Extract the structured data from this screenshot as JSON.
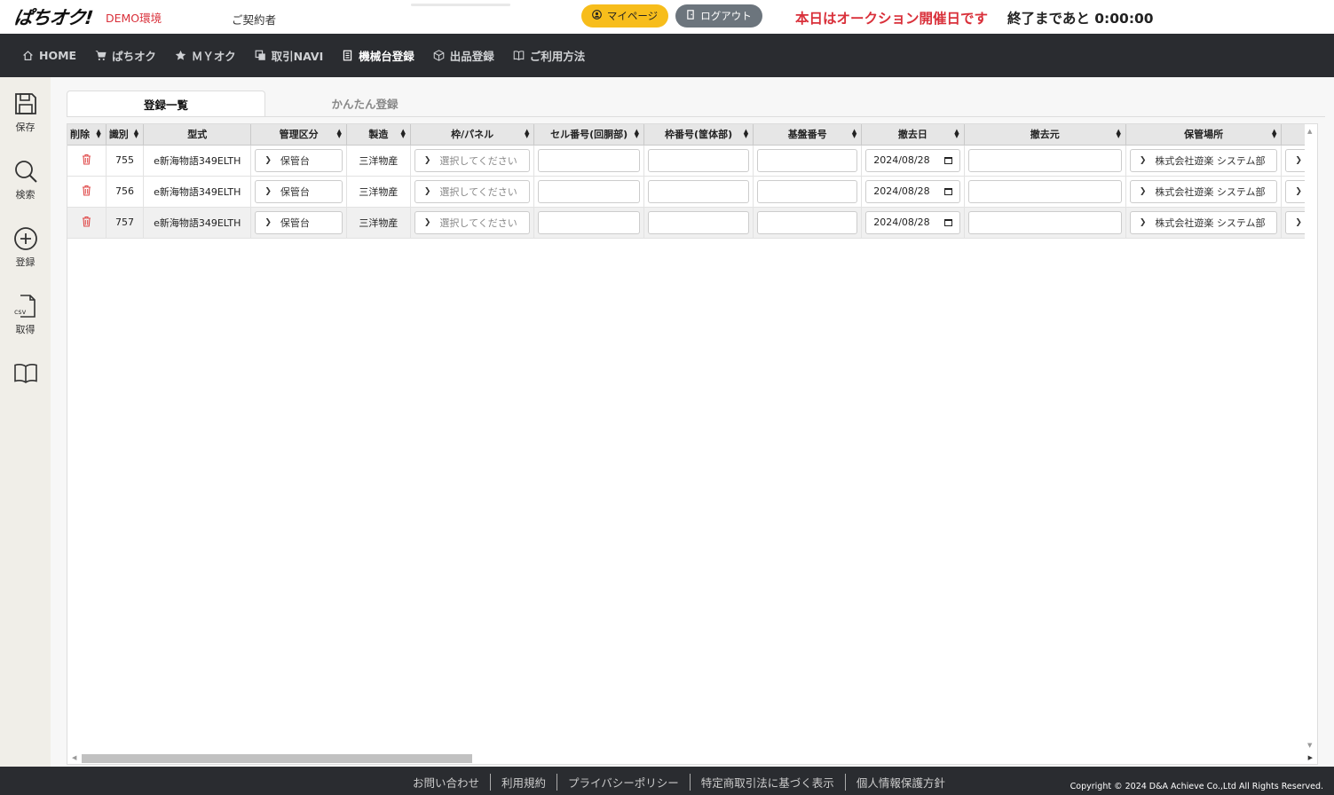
{
  "header": {
    "logo": "ぱちオク!",
    "env_label": "DEMO環境",
    "user_label": "ご契約者",
    "mypage_label": "マイページ",
    "logout_label": "ログアウト",
    "notice": "本日はオークション開催日です",
    "countdown_prefix": "終了まであと",
    "countdown_time": "0:00:00"
  },
  "nav": {
    "items": [
      {
        "label": "HOME",
        "icon": "home-icon"
      },
      {
        "label": "ぱちオク",
        "icon": "cart-icon"
      },
      {
        "label": "ＭＹオク",
        "icon": "star-icon"
      },
      {
        "label": "取引NAVI",
        "icon": "copy-icon"
      },
      {
        "label": "機械台登録",
        "icon": "clipboard-icon"
      },
      {
        "label": "出品登録",
        "icon": "box-icon"
      },
      {
        "label": "ご利用方法",
        "icon": "book-icon"
      }
    ],
    "active_index": 4
  },
  "sidebar": {
    "items": [
      {
        "label": "保存",
        "icon": "save-icon"
      },
      {
        "label": "検索",
        "icon": "search-icon"
      },
      {
        "label": "登録",
        "icon": "add-circle-icon"
      },
      {
        "label": "取得",
        "icon": "csv-file-icon"
      },
      {
        "label": "",
        "icon": "book-icon"
      }
    ],
    "csv_text": "csv"
  },
  "tabs": [
    {
      "label": "登録一覧",
      "active": true
    },
    {
      "label": "かんたん登録",
      "active": false
    }
  ],
  "table": {
    "columns": [
      "削除",
      "識別",
      "型式",
      "管理区分",
      "製造",
      "枠/パネル",
      "セル番号(回胴部)",
      "枠番号(筐体部)",
      "基盤番号",
      "撤去日",
      "撤去元",
      "保管場所"
    ],
    "rows": [
      {
        "id": "755",
        "model": "e新海物語349ELTH",
        "category": "保管台",
        "maker": "三洋物産",
        "frame": "選択してください",
        "removal_date": "2024/08/28",
        "storage": "株式会社遊楽 システム部"
      },
      {
        "id": "756",
        "model": "e新海物語349ELTH",
        "category": "保管台",
        "maker": "三洋物産",
        "frame": "選択してください",
        "removal_date": "2024/08/28",
        "storage": "株式会社遊楽 システム部"
      },
      {
        "id": "757",
        "model": "e新海物語349ELTH",
        "category": "保管台",
        "maker": "三洋物産",
        "frame": "選択してください",
        "removal_date": "2024/08/28",
        "storage": "株式会社遊楽 システム部"
      }
    ]
  },
  "footer": {
    "links": [
      "お問い合わせ",
      "利用規約",
      "プライバシーポリシー",
      "特定商取引法に基づく表示",
      "個人情報保護方針"
    ],
    "copyright": "Copyright © 2024 D&A Achieve Co.,Ltd All Rights Reserved."
  },
  "colors": {
    "accent_red": "#d9303a",
    "mypage_yellow": "#f7bd1b",
    "logout_gray": "#6c757d",
    "nav_dark": "#2a2c30"
  }
}
